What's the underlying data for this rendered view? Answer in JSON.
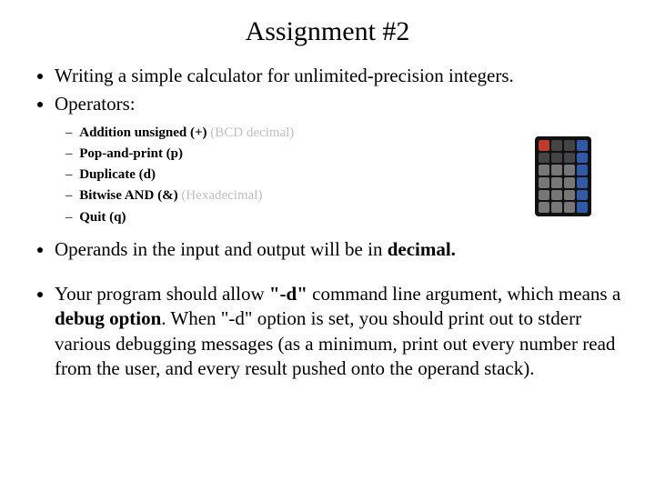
{
  "title": "Assignment #2",
  "bullets": {
    "intro1": "Writing a simple calculator for unlimited-precision integers.",
    "intro2": "Operators:",
    "operands": "Operands in the input and output will be in ",
    "operands_bold": "decimal.",
    "debug_pre": "Your program should allow ",
    "debug_flag": "\"-d\"",
    "debug_mid": " command line argument, which means  a ",
    "debug_opt": "debug option",
    "debug_post": ". When \"-d\" option is set, you should print out to stderr various debugging messages (as a minimum, print out every number read from the user, and every result pushed onto the operand stack)."
  },
  "sub": {
    "s1_bold": "Addition unsigned (+)",
    "s1_gray": " (BCD decimal)",
    "s2": "Pop-and-print (p)",
    "s3": "Duplicate (d)",
    "s4_bold": "Bitwise AND (&)",
    "s4_gray": " (Hexadecimal)",
    "s5": "Quit (q)"
  }
}
